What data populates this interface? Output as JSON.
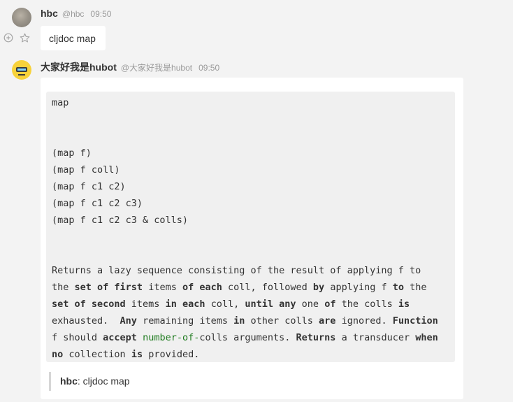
{
  "messages": [
    {
      "name": "hbc",
      "handle": "@hbc",
      "time": "09:50",
      "text": "cljdoc map"
    },
    {
      "name": "大家好我是hubot",
      "handle": "@大家好我是hubot",
      "time": "09:50",
      "code": {
        "title": "map",
        "signatures": [
          "(map f)",
          "(map f coll)",
          "(map f c1 c2)",
          "(map f c1 c2 c3)",
          "(map f c1 c2 c3 & colls)"
        ],
        "doc_lines": [
          [
            "Returns a lazy sequence consisting of the result of applying f to"
          ],
          [
            "the ",
            "set of first",
            " items ",
            "of each",
            " coll, followed ",
            "by",
            " applying f ",
            "to",
            " the"
          ],
          [
            "set of second",
            " items ",
            "in each",
            " coll, ",
            "until any",
            " one ",
            "of",
            " the colls ",
            "is"
          ],
          [
            "exhausted.  ",
            "Any",
            " remaining items ",
            "in",
            " other colls ",
            "are",
            " ignored. ",
            "Function"
          ],
          [
            "f should ",
            "accept",
            " ",
            "number-of-",
            "colls arguments. ",
            "Returns",
            " a transducer ",
            "when"
          ],
          [
            "no",
            " collection ",
            "is",
            " provided."
          ]
        ]
      },
      "quote": {
        "name": "hbc",
        "separator": ":",
        "text": " cljdoc map"
      }
    }
  ],
  "icons": {
    "reply": "reply-icon",
    "star": "star-icon"
  }
}
